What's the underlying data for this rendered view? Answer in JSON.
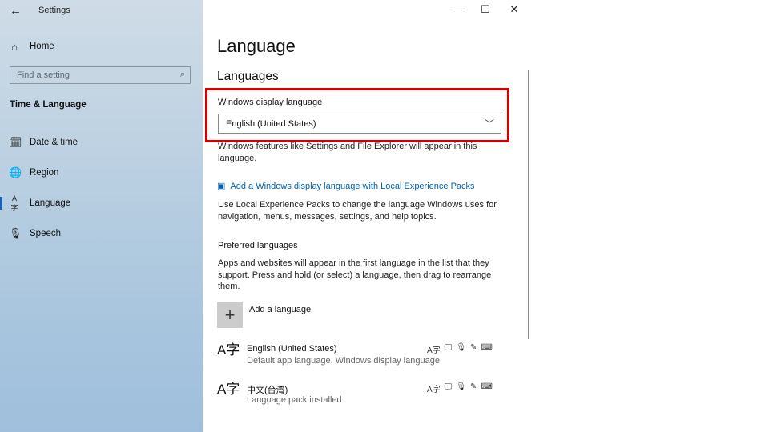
{
  "app": {
    "title": "Settings",
    "back_glyph": "←"
  },
  "window_controls": {
    "minimize": "—",
    "maximize": "☐",
    "close": "✕"
  },
  "sidebar": {
    "home": {
      "label": "Home",
      "icon": "home-icon"
    },
    "search": {
      "placeholder": "Find a setting",
      "icon": "search-icon"
    },
    "section": "Time & Language",
    "items": [
      {
        "label": "Date & time",
        "icon": "calendar-clock-icon",
        "glyph": "🗓"
      },
      {
        "label": "Region",
        "icon": "globe-icon",
        "glyph": "🌐"
      },
      {
        "label": "Language",
        "icon": "language-icon",
        "glyph": "A字"
      },
      {
        "label": "Speech",
        "icon": "microphone-icon",
        "glyph": "🎙"
      }
    ],
    "active": "Language"
  },
  "main": {
    "title": "Language",
    "languages_heading": "Languages",
    "display_language": {
      "label": "Windows display language",
      "selected": "English (United States)",
      "description": "Windows features like Settings and File Explorer will appear in this language."
    },
    "local_packs": {
      "link": "Add a Windows display language with Local Experience Packs",
      "description": "Use Local Experience Packs to change the language Windows uses for navigation, menus, messages, settings, and help topics."
    },
    "preferred": {
      "heading": "Preferred languages",
      "description": "Apps and websites will appear in the first language in the list that they support. Press and hold (or select) a language, then drag to rearrange them.",
      "add_label": "Add a language",
      "languages": [
        {
          "name": "English (United States)",
          "sub": "Default app language, Windows display language",
          "glyph": "A字",
          "features": [
            "A字",
            "🖵",
            "🎙",
            "✎",
            "⌨"
          ]
        },
        {
          "name": "中文(台灣)",
          "sub": "Language pack installed",
          "glyph": "A字",
          "features": [
            "A字",
            "🖵",
            "🎙",
            "✎",
            "⌨"
          ]
        }
      ]
    }
  },
  "colors": {
    "accent": "#0063b1",
    "highlight": "#d40000"
  }
}
